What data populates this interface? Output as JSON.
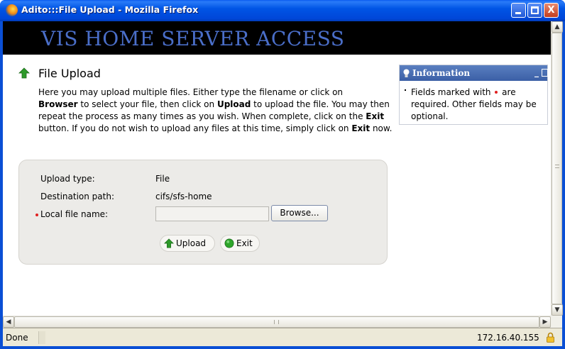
{
  "window": {
    "title": "Adito:::File Upload - Mozilla Firefox",
    "minimize_icon": "minimize-icon",
    "maximize_icon": "maximize-icon",
    "close_icon": "close-icon",
    "close_label": "X"
  },
  "banner": {
    "text": "VIS HOME SERVER ACCESS"
  },
  "page": {
    "title": "File Upload",
    "title_icon": "up-arrow-icon",
    "intro": {
      "p1": "Here you may upload multiple files. Either type the filename or click on",
      "browser_word": "Browser",
      "p2": " to select your file, then click on ",
      "upload_word": "Upload",
      "p3": " to upload the file. You may then repeat the process as many times as you wish. When complete, click on the ",
      "exit_word": "Exit",
      "p4": " button. If you do not wish to upload any files at this time, simply click on ",
      "exit_word2": "Exit",
      "p5": " now."
    }
  },
  "form": {
    "upload_type_label": "Upload type:",
    "upload_type_value": "File",
    "destination_label": "Destination path:",
    "destination_value": "cifs/sfs-home",
    "local_file_label": "Local file name:",
    "local_file_value": "",
    "browse_label": "Browse...",
    "upload_label": "Upload",
    "exit_label": "Exit"
  },
  "info": {
    "title": "Information",
    "text_before": "Fields marked with ",
    "text_after": " are required. Other fields may be optional.",
    "minimize": "_"
  },
  "status": {
    "text": "Done",
    "host": "172.16.40.155",
    "lock_icon": "padlock-icon"
  },
  "colors": {
    "titlebar": "#0055e5",
    "banner_bg": "#000000",
    "banner_text": "#4a6ec8",
    "info_header": "#3b5fa6",
    "required_dot": "#e02020",
    "form_panel": "#ecebe8"
  }
}
